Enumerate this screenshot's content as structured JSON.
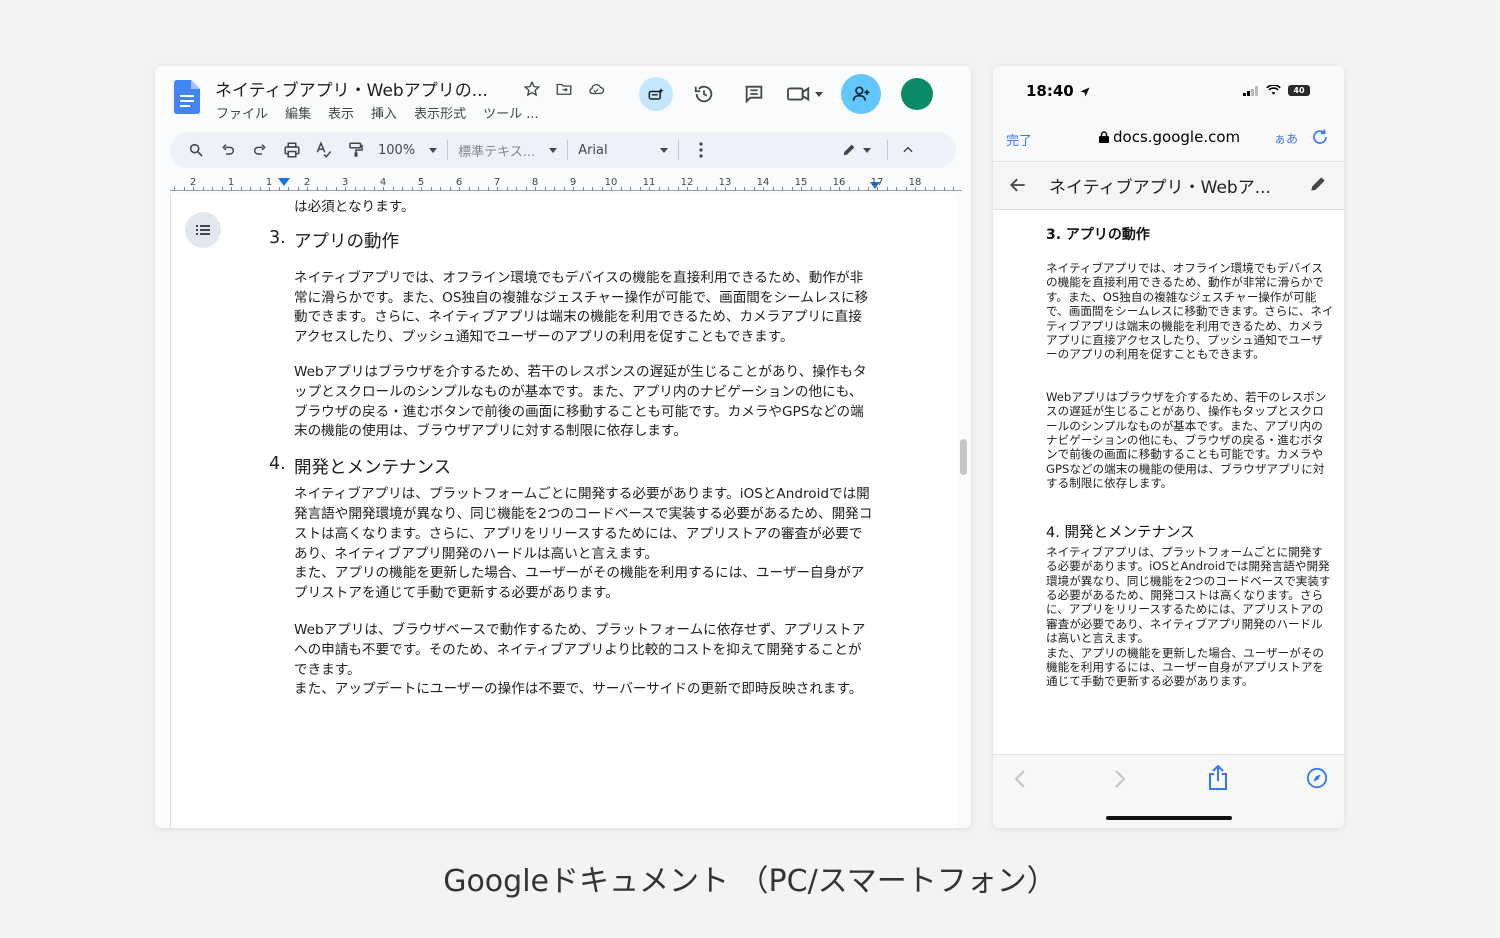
{
  "pc": {
    "doc_title": "ネイティブアプリ・Webアプリの...",
    "menu": [
      "ファイル",
      "編集",
      "表示",
      "挿入",
      "表示形式",
      "ツール ..."
    ],
    "toolbar": {
      "zoom": "100%",
      "style": "標準テキス...",
      "font": "Arial"
    },
    "ruler_labels": [
      "2",
      "1",
      "1",
      "2",
      "3",
      "4",
      "5",
      "6",
      "7",
      "8",
      "9",
      "10",
      "11",
      "12",
      "13",
      "14",
      "15",
      "16",
      "17",
      "18"
    ],
    "content": {
      "leadin": "は必須となります。",
      "section3_num": "3.",
      "section3_title": "アプリの動作",
      "section3_p1": "ネイティブアプリでは、オフライン環境でもデバイスの機能を直接利用できるため、動作が非常に滑らかです。また、OS独自の複雑なジェスチャー操作が可能で、画面間をシームレスに移動できます。さらに、ネイティブアプリは端末の機能を利用できるため、カメラアプリに直接アクセスしたり、プッシュ通知でユーザーのアプリの利用を促すこともできます。",
      "section3_p2": "Webアプリはブラウザを介するため、若干のレスポンスの遅延が生じることがあり、操作もタップとスクロールのシンプルなものが基本です。また、アプリ内のナビゲーションの他にも、ブラウザの戻る・進むボタンで前後の画面に移動することも可能です。カメラやGPSなどの端末の機能の使用は、ブラウザアプリに対する制限に依存します。",
      "section4_num": "4.",
      "section4_title": "開発とメンテナンス",
      "section4_p1": "ネイティブアプリは、プラットフォームごとに開発する必要があります。iOSとAndroidでは開発言語や開発環境が異なり、同じ機能を2つのコードベースで実装する必要があるため、開発コストは高くなります。さらに、アプリをリリースするためには、アプリストアの審査が必要であり、ネイティブアプリ開発のハードルは高いと言えます。",
      "section4_p2": "また、アプリの機能を更新した場合、ユーザーがその機能を利用するには、ユーザー自身がアプリストアを通じて手動で更新する必要があります。",
      "section4_p3": "Webアプリは、ブラウザベースで動作するため、プラットフォームに依存せず、アプリストアへの申請も不要です。そのため、ネイティブアプリより比較的コストを抑えて開発することができます。",
      "section4_p4": "また、アップデートにユーザーの操作は不要で、サーバーサイドの更新で即時反映されます。"
    }
  },
  "phone": {
    "time": "18:40",
    "battery": "40",
    "done": "完了",
    "url": "docs.google.com",
    "aa": "ぁあ",
    "doc_title": "ネイティブアプリ・Webア...",
    "content": {
      "section3_heading": "3. アプリの動作",
      "section3_p1": "ネイティブアプリでは、オフライン環境でもデバイスの機能を直接利用できるため、動作が非常に滑らかです。また、OS独自の複雑なジェスチャー操作が可能で、画面間をシームレスに移動できます。さらに、ネイティブアプリは端末の機能を利用できるため、カメラアプリに直接アクセスしたり、プッシュ通知でユーザーのアプリの利用を促すこともできます。",
      "section3_p2": "Webアプリはブラウザを介するため、若干のレスポンスの遅延が生じることがあり、操作もタップとスクロールのシンプルなものが基本です。また、アプリ内のナビゲーションの他にも、ブラウザの戻る・進むボタンで前後の画面に移動することも可能です。カメラやGPSなどの端末の機能の使用は、ブラウザアプリに対する制限に依存します。",
      "section4_heading": "4. 開発とメンテナンス",
      "section4_p1": "ネイティブアプリは、プラットフォームごとに開発する必要があります。iOSとAndroidでは開発言語や開発環境が異なり、同じ機能を2つのコードベースで実装する必要があるため、開発コストは高くなります。さらに、アプリをリリースするためには、アプリストアの審査が必要であり、ネイティブアプリ開発のハードルは高いと言えます。",
      "section4_p2": "また、アプリの機能を更新した場合、ユーザーがその機能を利用するには、ユーザー自身がアプリストアを通じて手動で更新する必要があります。"
    }
  },
  "caption": "Googleドキュメント （PC/スマートフォン）",
  "colors": {
    "accent_blue": "#0b57d0",
    "ios_blue": "#3478f6",
    "avatar": "#0b8a68",
    "share_bg": "#62c6ff"
  },
  "icons": [
    "docs-logo-icon",
    "star-icon",
    "move-folder-icon",
    "cloud-saved-icon",
    "gemini-icon",
    "history-icon",
    "comment-icon",
    "meet-icon",
    "add-person-icon",
    "search-icon",
    "undo-icon",
    "redo-icon",
    "print-icon",
    "spellcheck-icon",
    "paint-format-icon",
    "more-icon",
    "pencil-icon",
    "collapse-icon",
    "outline-icon",
    "location-arrow-icon",
    "signal-icon",
    "wifi-icon",
    "lock-icon",
    "reload-icon",
    "back-arrow-icon",
    "edit-icon",
    "share-icon",
    "compass-icon"
  ]
}
